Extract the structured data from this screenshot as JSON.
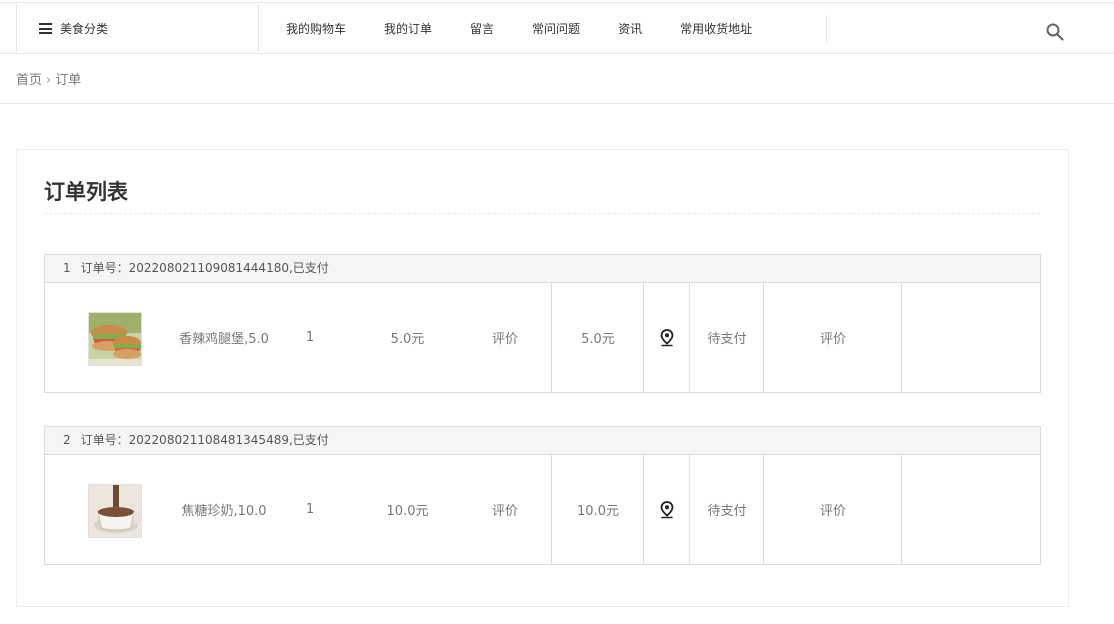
{
  "nav": {
    "category_label": "美食分类",
    "items": [
      {
        "label": "我的购物车"
      },
      {
        "label": "我的订单"
      },
      {
        "label": "留言"
      },
      {
        "label": "常问问题"
      },
      {
        "label": "资讯"
      },
      {
        "label": "常用收货地址"
      }
    ]
  },
  "breadcrumb": {
    "home": "首页",
    "separator": "›",
    "current": "订单"
  },
  "page": {
    "title": "订单列表"
  },
  "orders": [
    {
      "index": "1",
      "header": "订单号：20220802110908144​4180,已支付",
      "product": "香辣鸡腿堡,5.0",
      "image": "burger",
      "quantity": "1",
      "price": "5.0元",
      "review_label": "评价",
      "total": "5.0元",
      "location_icon": "map-pin-icon",
      "status": "待支付",
      "review_label_2": "评价"
    },
    {
      "index": "2",
      "header": "订单号：20220802110848134​5489,已支付",
      "product": "焦糖珍奶,10.0",
      "image": "milk-tea",
      "quantity": "1",
      "price": "10.0元",
      "review_label": "评价",
      "total": "10.0元",
      "location_icon": "map-pin-icon",
      "status": "待支付",
      "review_label_2": "评价"
    }
  ]
}
